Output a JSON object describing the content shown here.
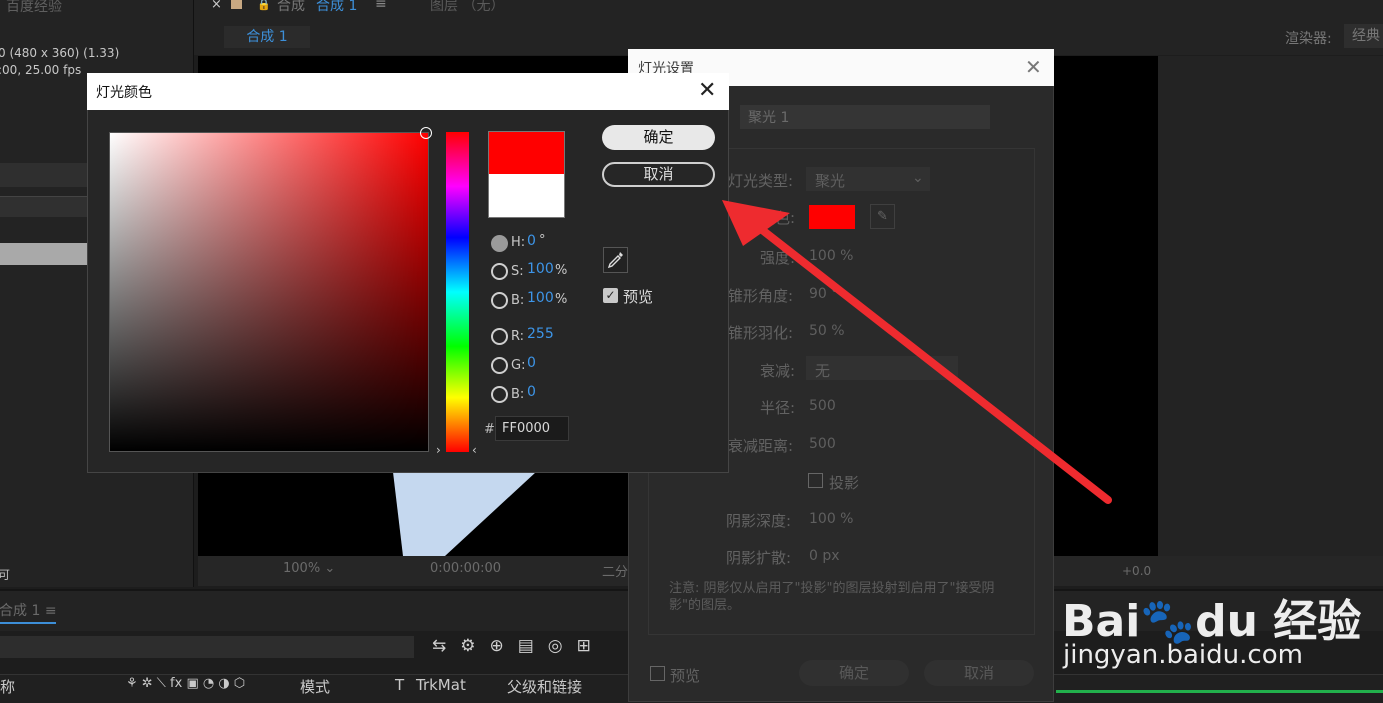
{
  "project": {
    "title": "百度经验",
    "info_line1": "0  (480 x 360) (1.33)",
    "info_line2": ":00, 25.00 fps",
    "bottom_text": "可"
  },
  "comp_panel": {
    "tab_comp_label": "合成",
    "tab_comp_name": "合成 1",
    "layer_tab": "图层  （无）",
    "subtab": "合成 1",
    "renderer_label": "渲染器:",
    "renderer_value": "经典"
  },
  "viewer_toolbar": {
    "zoom": "100%",
    "time": "0:00:00:00",
    "view_label": "二分",
    "exposure": "+0.0"
  },
  "timeline": {
    "tab": "合成 1",
    "columns": {
      "name": "称",
      "mode": "模式",
      "t": "T",
      "trkmat": "TrkMat",
      "parent": "父级和链接"
    }
  },
  "light_settings": {
    "title": "灯光设置",
    "name_value": "聚光 1",
    "rows": {
      "light_type_label": "灯光类型:",
      "light_type_value": "聚光",
      "color_label": "颜色:",
      "intensity_label": "强度:",
      "intensity_value": "100 %",
      "cone_angle_label": "锥形角度:",
      "cone_angle_value": "90 °",
      "cone_feather_label": "锥形羽化:",
      "cone_feather_value": "50 %",
      "falloff_label": "衰减:",
      "falloff_value": "无",
      "radius_label": "半径:",
      "radius_value": "500",
      "falloff_distance_label": "衰减距离:",
      "falloff_distance_value": "500",
      "cast_shadows_label": "投影",
      "shadow_darkness_label": "阴影深度:",
      "shadow_darkness_value": "100 %",
      "shadow_diffusion_label": "阴影扩散:",
      "shadow_diffusion_value": "0 px"
    },
    "note": "注意: 阴影仅从启用了\"投影\"的图层投射到启用了\"接受阴影\"的图层。",
    "preview_label": "预览",
    "ok_label": "确定",
    "cancel_label": "取消",
    "color_hex": "#ff0000"
  },
  "color_dialog": {
    "title": "灯光颜色",
    "ok_label": "确定",
    "cancel_label": "取消",
    "preview_label": "预览",
    "preview_checked": true,
    "new_color": "#ff0000",
    "old_color": "#ffffff",
    "fields": {
      "h_label": "H:",
      "h_value": "0",
      "h_unit": "°",
      "s_label": "S:",
      "s_value": "100",
      "s_unit": "%",
      "b_label": "B:",
      "b_value": "100",
      "b_unit": "%",
      "r_label": "R:",
      "r_value": "255",
      "g_label": "G:",
      "g_value": "0",
      "b2_label": "B:",
      "b2_value": "0"
    },
    "hex_hash": "#",
    "hex_value": "FF0000",
    "selected_mode": "H"
  },
  "annotation": {
    "arrow_color": "#ee2b2f"
  },
  "watermark": {
    "logo": "Bai du 经验",
    "url": "jingyan.baidu.com"
  }
}
